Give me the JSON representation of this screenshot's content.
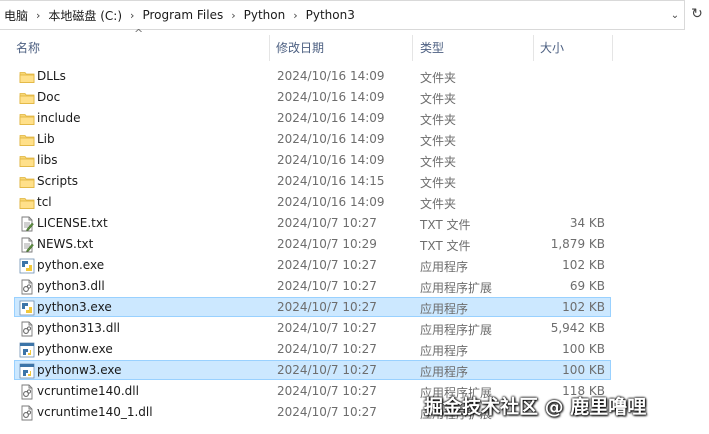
{
  "address_bar": {
    "crumbs": [
      "电脑",
      "本地磁盘 (C:)",
      "Program Files",
      "Python",
      "Python3"
    ]
  },
  "columns": {
    "name": "名称",
    "date": "修改日期",
    "type": "类型",
    "size": "大小"
  },
  "files": [
    {
      "name": "DLLs",
      "date": "2024/10/16 14:09",
      "type": "文件夹",
      "size": "",
      "icon": "folder-icon",
      "selected": false
    },
    {
      "name": "Doc",
      "date": "2024/10/16 14:09",
      "type": "文件夹",
      "size": "",
      "icon": "folder-icon",
      "selected": false
    },
    {
      "name": "include",
      "date": "2024/10/16 14:09",
      "type": "文件夹",
      "size": "",
      "icon": "folder-icon",
      "selected": false
    },
    {
      "name": "Lib",
      "date": "2024/10/16 14:09",
      "type": "文件夹",
      "size": "",
      "icon": "folder-icon",
      "selected": false
    },
    {
      "name": "libs",
      "date": "2024/10/16 14:09",
      "type": "文件夹",
      "size": "",
      "icon": "folder-icon",
      "selected": false
    },
    {
      "name": "Scripts",
      "date": "2024/10/16 14:15",
      "type": "文件夹",
      "size": "",
      "icon": "folder-icon",
      "selected": false
    },
    {
      "name": "tcl",
      "date": "2024/10/16 14:09",
      "type": "文件夹",
      "size": "",
      "icon": "folder-icon",
      "selected": false
    },
    {
      "name": "LICENSE.txt",
      "date": "2024/10/7 10:27",
      "type": "TXT 文件",
      "size": "34 KB",
      "icon": "text-file-icon",
      "selected": false
    },
    {
      "name": "NEWS.txt",
      "date": "2024/10/7 10:29",
      "type": "TXT 文件",
      "size": "1,879 KB",
      "icon": "text-file-icon",
      "selected": false
    },
    {
      "name": "python.exe",
      "date": "2024/10/7 10:27",
      "type": "应用程序",
      "size": "102 KB",
      "icon": "python-exe-icon",
      "selected": false
    },
    {
      "name": "python3.dll",
      "date": "2024/10/7 10:27",
      "type": "应用程序扩展",
      "size": "69 KB",
      "icon": "dll-icon",
      "selected": false
    },
    {
      "name": "python3.exe",
      "date": "2024/10/7 10:27",
      "type": "应用程序",
      "size": "102 KB",
      "icon": "python-exe-icon",
      "selected": true
    },
    {
      "name": "python313.dll",
      "date": "2024/10/7 10:27",
      "type": "应用程序扩展",
      "size": "5,942 KB",
      "icon": "dll-icon",
      "selected": false
    },
    {
      "name": "pythonw.exe",
      "date": "2024/10/7 10:27",
      "type": "应用程序",
      "size": "100 KB",
      "icon": "pythonw-exe-icon",
      "selected": false
    },
    {
      "name": "pythonw3.exe",
      "date": "2024/10/7 10:27",
      "type": "应用程序",
      "size": "100 KB",
      "icon": "pythonw-exe-icon",
      "selected": true
    },
    {
      "name": "vcruntime140.dll",
      "date": "2024/10/7 10:27",
      "type": "应用程序扩展",
      "size": "118 KB",
      "icon": "dll-icon",
      "selected": false
    },
    {
      "name": "vcruntime140_1.dll",
      "date": "2024/10/7 10:27",
      "type": "应用程序扩展",
      "size": "",
      "icon": "dll-icon",
      "selected": false
    }
  ],
  "watermark": "掘金技术社区 @ 鹿里噜哩",
  "colors": {
    "selection_bg": "#cce8ff",
    "selection_border": "#99d1ff",
    "folder": "#f8d775",
    "header_text": "#4d6082"
  }
}
